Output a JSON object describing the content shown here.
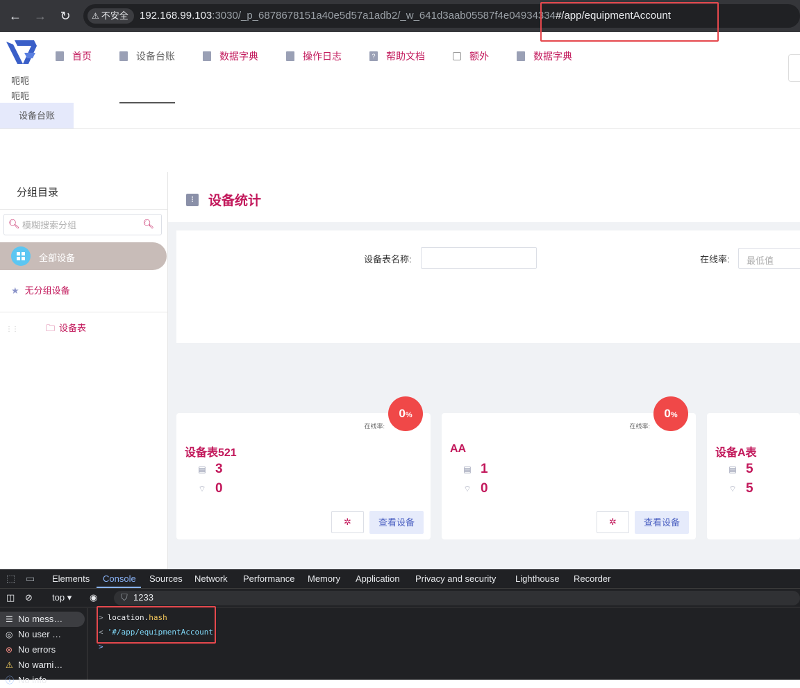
{
  "browser": {
    "security_label": "不安全",
    "url_host": "192.168.99.103",
    "url_path": ":3030/_p_6878678151a40e5d57a1adb2/_w_641d3aab05587f4e04934334",
    "url_hash": "#/app/equipmentAccount",
    "accent_highlight": "#e5484d"
  },
  "app": {
    "user_name_line1": "呃呃",
    "user_name_line2": "呃呃",
    "nav": [
      {
        "label": "首页",
        "icon": "list-icon"
      },
      {
        "label": "设备台账",
        "icon": "device-icon"
      },
      {
        "label": "数据字典",
        "icon": "book-icon"
      },
      {
        "label": "操作日志",
        "icon": "book-icon"
      },
      {
        "label": "帮助文档",
        "icon": "help-icon"
      },
      {
        "label": "额外",
        "icon": "checkbox-icon"
      },
      {
        "label": "数据字典",
        "icon": "book-icon"
      }
    ],
    "active_tab": "设备台账",
    "brand_color": "#c2185b"
  },
  "sidebar": {
    "title": "分组目录",
    "search_placeholder": "模糊搜索分组",
    "all_devices": "全部设备",
    "ungrouped": "无分组设备",
    "tree_items": [
      "设备表"
    ]
  },
  "main": {
    "title": "设备统计",
    "filter": {
      "name_label": "设备表名称:",
      "name_value": "",
      "online_label": "在线率:",
      "online_min_placeholder": "最低值"
    },
    "cards": [
      {
        "name": "设备表521",
        "online_label": "在线率:",
        "rate": "0",
        "rate_unit": "%",
        "device_count": "3",
        "online_count": "0",
        "view_label": "查看设备"
      },
      {
        "name": "AA",
        "online_label": "在线率:",
        "rate": "0",
        "rate_unit": "%",
        "device_count": "1",
        "online_count": "0",
        "view_label": "查看设备"
      },
      {
        "name": "设备A表",
        "device_count": "5",
        "online_count": "5"
      }
    ]
  },
  "devtools": {
    "tabs": [
      "Elements",
      "Console",
      "Sources",
      "Network",
      "Performance",
      "Memory",
      "Application",
      "Privacy and security",
      "Lighthouse",
      "Recorder"
    ],
    "active_tab": "Console",
    "context": "top",
    "filter_value": "1233",
    "sidebar": [
      {
        "label": "No mess…",
        "icon": "list-icon"
      },
      {
        "label": "No user …",
        "icon": "user-icon"
      },
      {
        "label": "No errors",
        "icon": "error-icon"
      },
      {
        "label": "No warni…",
        "icon": "warning-icon"
      },
      {
        "label": "No info",
        "icon": "info-icon"
      }
    ],
    "console": {
      "input_object": "location",
      "input_prop": "hash",
      "output": "'#/app/equipmentAccount'"
    }
  }
}
